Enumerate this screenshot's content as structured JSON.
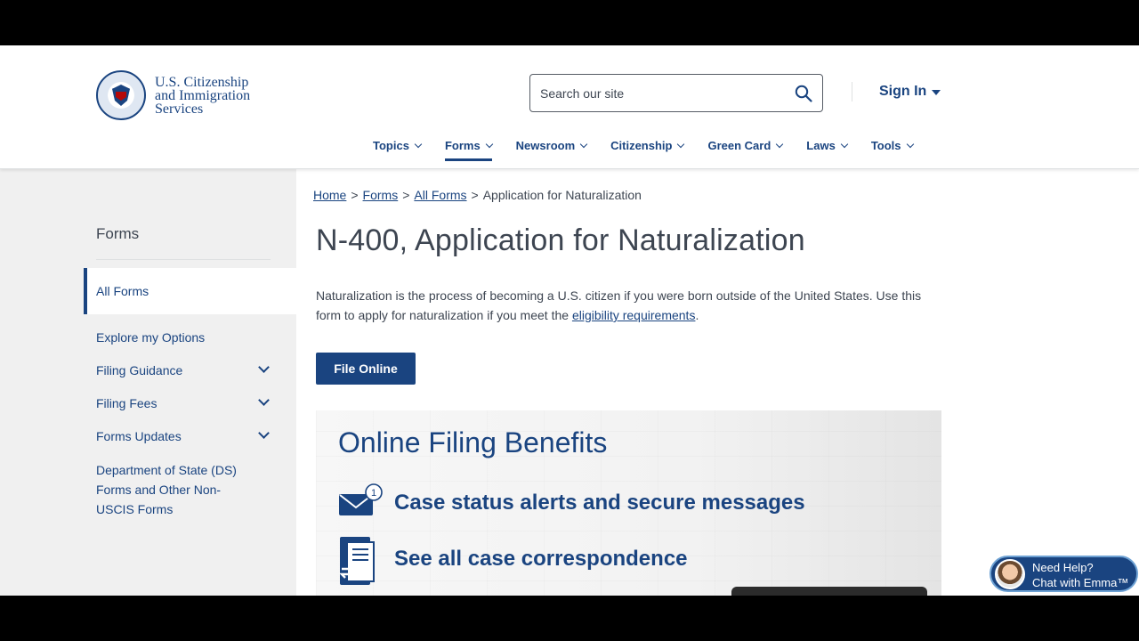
{
  "header": {
    "agency_line1": "U.S. Citizenship",
    "agency_line2": "and Immigration",
    "agency_line3": "Services",
    "search_placeholder": "Search our site",
    "sign_in": "Sign In"
  },
  "nav": {
    "items": [
      "Topics",
      "Forms",
      "Newsroom",
      "Citizenship",
      "Green Card",
      "Laws",
      "Tools"
    ],
    "active": "Forms"
  },
  "sidebar": {
    "heading": "Forms",
    "active_item": "All Forms",
    "items": [
      {
        "label": "Explore my Options"
      },
      {
        "label": "Filing Guidance",
        "expandable": true
      },
      {
        "label": "Filing Fees",
        "expandable": true
      },
      {
        "label": "Forms Updates",
        "expandable": true
      }
    ],
    "multi_line_item": [
      "Department of State (DS)",
      "Forms and Other Non-",
      "USCIS Forms"
    ]
  },
  "breadcrumb": {
    "items": [
      "Home",
      "Forms",
      "All Forms"
    ],
    "current": "Application for Naturalization",
    "separator": ">"
  },
  "main": {
    "title": "N-400, Application for Naturalization",
    "intro_text": "Naturalization is the process of becoming a U.S. citizen if you were born outside of the United States. Use this form to apply for naturalization if you meet the ",
    "intro_link": "eligibility requirements",
    "intro_end": ".",
    "file_online_button": "File Online"
  },
  "benefits": {
    "title": "Online Filing Benefits",
    "items": [
      {
        "icon": "envelope-alert-icon",
        "text": "Case status alerts and secure messages",
        "badge": "1"
      },
      {
        "icon": "document-exchange-icon",
        "text": "See all case correspondence"
      }
    ]
  },
  "chat": {
    "line1": "Need Help?",
    "line2": "Chat with Emma™"
  },
  "colors": {
    "brand_blue": "#1a4480",
    "text_gray": "#3d4551",
    "sidebar_bg": "#f0f0f0"
  }
}
